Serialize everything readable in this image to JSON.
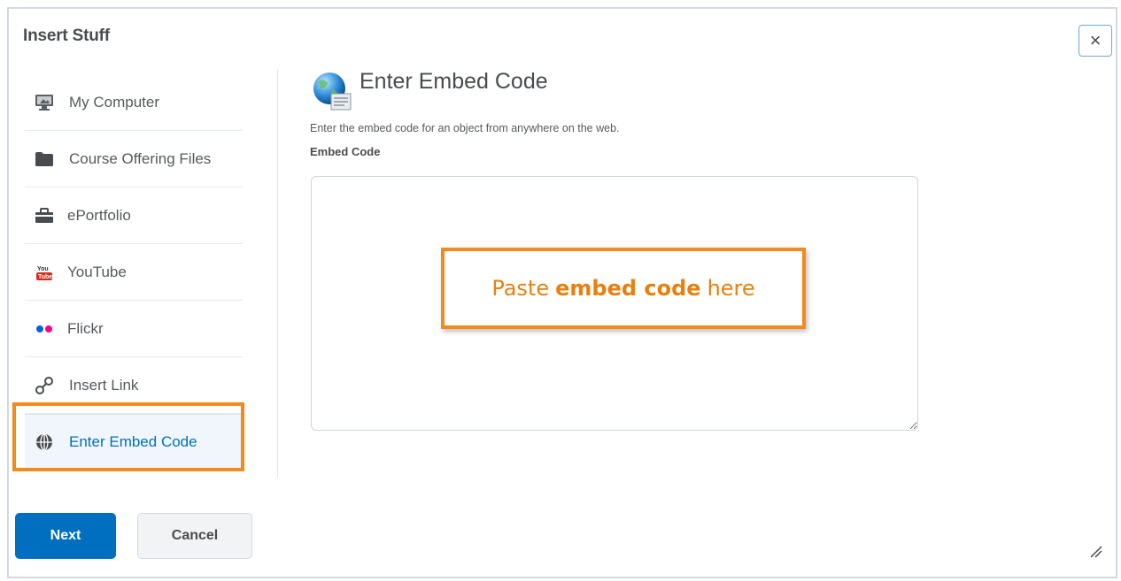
{
  "dialog": {
    "title": "Insert Stuff",
    "close_label": "×"
  },
  "sidebar": {
    "items": [
      {
        "label": "My Computer",
        "icon": "monitor-icon"
      },
      {
        "label": "Course Offering Files",
        "icon": "folder-icon"
      },
      {
        "label": "ePortfolio",
        "icon": "briefcase-icon"
      },
      {
        "label": "YouTube",
        "icon": "youtube-icon"
      },
      {
        "label": "Flickr",
        "icon": "flickr-icon"
      },
      {
        "label": "Insert Link",
        "icon": "link-icon"
      },
      {
        "label": "Enter Embed Code",
        "icon": "globe-icon",
        "active": true
      }
    ]
  },
  "main": {
    "title": "Enter Embed Code",
    "description": "Enter the embed code for an object from anywhere on the web.",
    "field_label": "Embed Code",
    "embed_value": ""
  },
  "callout": {
    "prefix": "Paste",
    "bold": "embed code",
    "suffix": "here"
  },
  "footer": {
    "next_label": "Next",
    "cancel_label": "Cancel"
  },
  "colors": {
    "accent": "#006fbf",
    "highlight": "#f28a1c"
  }
}
